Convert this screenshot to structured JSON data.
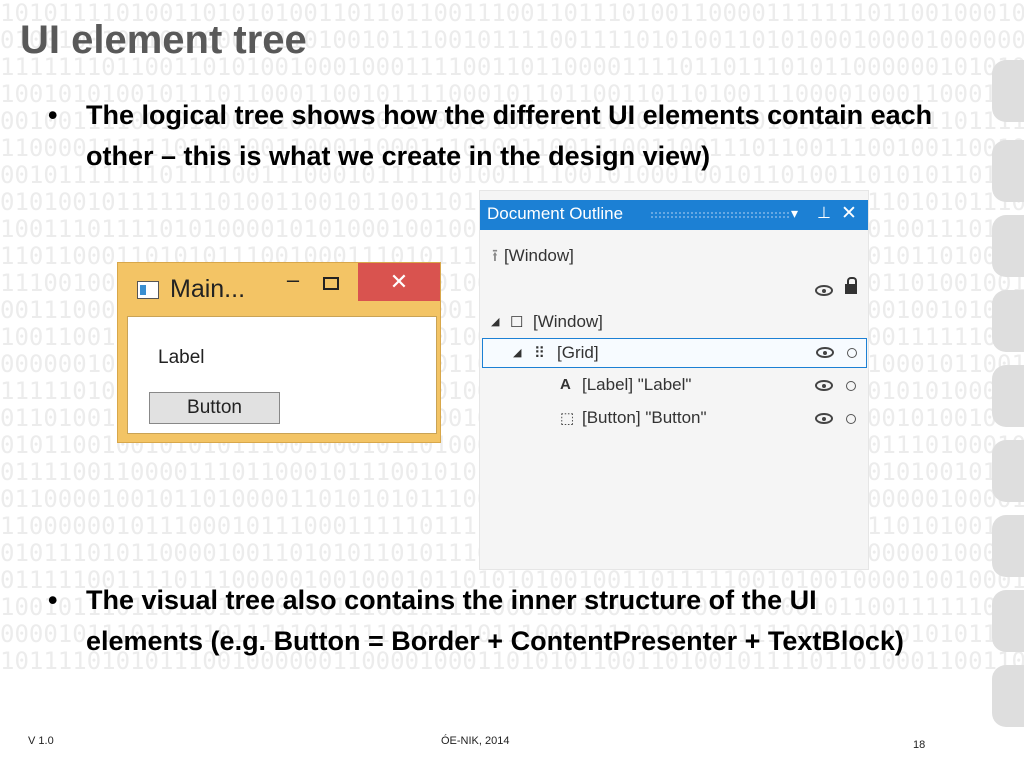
{
  "slide": {
    "title": "UI element tree",
    "bullets": [
      "The logical tree shows how the different UI elements contain each other – this is what we create in the design view)",
      "The visual tree also contains the inner structure of the UI elements (e.g. Button = Border + ContentPresenter + TextBlock)"
    ],
    "footer": {
      "version": "V 1.0",
      "org": "ÓE-NIK, 2014",
      "page": "18"
    }
  },
  "mini_window": {
    "title": "Main...",
    "minimize_glyph": "–",
    "close_glyph": "✕",
    "label_text": "Label",
    "button_text": "Button"
  },
  "document_outline": {
    "title": "Document Outline",
    "dropdown_glyph": "▾",
    "pin_glyph": "⊥",
    "close_glyph": "✕",
    "breadcrumb": "[Window]",
    "tree": [
      {
        "label": "[Window]",
        "icon": "window-icon"
      },
      {
        "label": "[Grid]",
        "icon": "grid-icon"
      },
      {
        "label": "[Label] \"Label\"",
        "icon": "label-icon"
      },
      {
        "label": "[Button] \"Button\"",
        "icon": "button-icon"
      }
    ]
  },
  "colors": {
    "title_text": "#595959",
    "outline_header": "#1c80d4",
    "window_frame": "#f3c465",
    "window_close": "#d9534f",
    "background_binary": "#ececec"
  }
}
